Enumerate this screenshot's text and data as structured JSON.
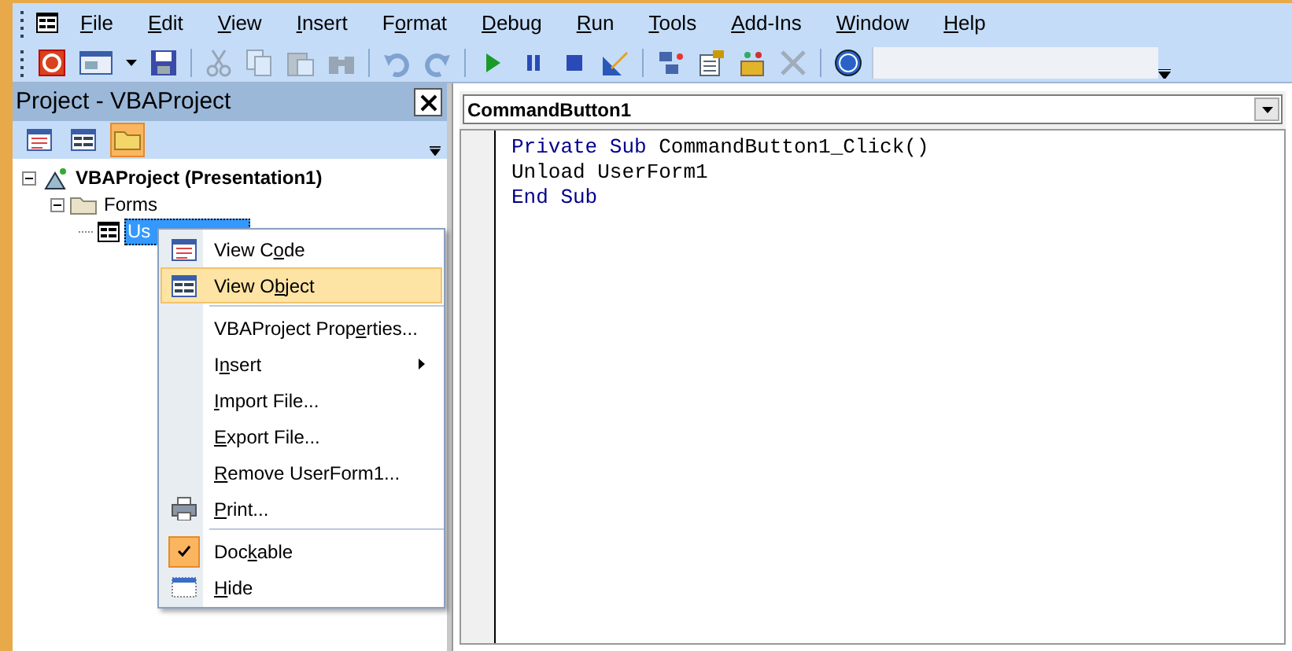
{
  "menu_bar": [
    {
      "key": "F",
      "after": "ile"
    },
    {
      "key": "E",
      "after": "dit"
    },
    {
      "key": "V",
      "after": "iew"
    },
    {
      "key": "I",
      "after": "nsert"
    },
    {
      "before": "F",
      "key": "o",
      "after": "rmat"
    },
    {
      "key": "D",
      "after": "ebug"
    },
    {
      "key": "R",
      "after": "un"
    },
    {
      "key": "T",
      "after": "ools"
    },
    {
      "key": "A",
      "after": "dd-Ins"
    },
    {
      "key": "W",
      "after": "indow"
    },
    {
      "key": "H",
      "after": "elp"
    }
  ],
  "toolbar": [
    {
      "kind": "powerpoint",
      "disabled": false
    },
    {
      "kind": "userform",
      "disabled": false
    },
    {
      "kind": "dropdown",
      "disabled": false
    },
    {
      "kind": "save",
      "disabled": false
    },
    {
      "kind": "sep"
    },
    {
      "kind": "cut",
      "disabled": true
    },
    {
      "kind": "copy",
      "disabled": true
    },
    {
      "kind": "paste",
      "disabled": true
    },
    {
      "kind": "find",
      "disabled": true
    },
    {
      "kind": "sep"
    },
    {
      "kind": "undo",
      "disabled": true
    },
    {
      "kind": "redo",
      "disabled": true
    },
    {
      "kind": "sep"
    },
    {
      "kind": "run",
      "disabled": false
    },
    {
      "kind": "pause",
      "disabled": false
    },
    {
      "kind": "stop",
      "disabled": false
    },
    {
      "kind": "design",
      "disabled": false
    },
    {
      "kind": "sep"
    },
    {
      "kind": "explorer",
      "disabled": false
    },
    {
      "kind": "properties",
      "disabled": false
    },
    {
      "kind": "browser",
      "disabled": false
    },
    {
      "kind": "toolbox",
      "disabled": true
    },
    {
      "kind": "sep"
    },
    {
      "kind": "help",
      "disabled": false
    }
  ],
  "project_panel": {
    "title": "Project - VBAProject",
    "toolbar": [
      {
        "kind": "code",
        "selected": false
      },
      {
        "kind": "object",
        "selected": false
      },
      {
        "kind": "folders",
        "selected": true
      }
    ],
    "tree": [
      {
        "label": "VBAProject (Presentation1)",
        "kind": "project",
        "selected": false,
        "expanded": true,
        "children": [
          {
            "label": "Forms",
            "kind": "folder",
            "selected": false,
            "expanded": true,
            "children": [
              {
                "label": "Us",
                "kind": "form",
                "selected": true
              }
            ]
          }
        ]
      }
    ]
  },
  "context_menu": [
    {
      "label": {
        "before": "View C",
        "key": "o",
        "after": "de"
      },
      "kind": "code",
      "selected": false
    },
    {
      "label": {
        "before": "View O",
        "key": "b",
        "after": "ject"
      },
      "kind": "object",
      "selected": true
    },
    {
      "kind": "sep"
    },
    {
      "label": {
        "before": "VBAProject Prop",
        "key": "e",
        "after": "rties..."
      },
      "kind": "plain",
      "selected": false
    },
    {
      "label": {
        "before": "I",
        "key": "n",
        "after": "sert"
      },
      "kind": "submenu",
      "selected": false
    },
    {
      "label": {
        "key": "I",
        "after": "mport File..."
      },
      "kind": "plain",
      "selected": false
    },
    {
      "label": {
        "key": "E",
        "after": "xport File..."
      },
      "kind": "plain",
      "selected": false
    },
    {
      "label": {
        "key": "R",
        "after": "emove UserForm1..."
      },
      "kind": "plain",
      "selected": false
    },
    {
      "label": {
        "key": "P",
        "after": "rint..."
      },
      "kind": "print",
      "selected": false
    },
    {
      "kind": "sep"
    },
    {
      "label": {
        "before": "Doc",
        "key": "k",
        "after": "able"
      },
      "kind": "check",
      "checked": true,
      "selected": false
    },
    {
      "label": {
        "key": "H",
        "after": "ide"
      },
      "kind": "hide",
      "selected": false
    }
  ],
  "code_window": {
    "object_dropdown": "CommandButton1",
    "lines": [
      [
        {
          "text": "Private Sub",
          "kind": "keyword"
        },
        {
          "text": " CommandButton1_Click()",
          "kind": "plain"
        }
      ],
      [
        {
          "text": "Unload UserForm1",
          "kind": "plain"
        }
      ],
      [
        {
          "text": "End Sub",
          "kind": "keyword"
        }
      ]
    ]
  }
}
